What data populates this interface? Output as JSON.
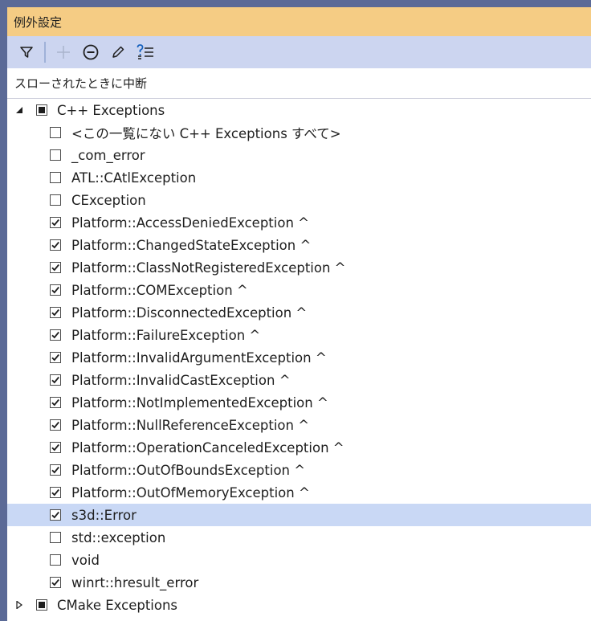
{
  "window": {
    "title": "例外設定"
  },
  "toolbar": {
    "buttons": [
      {
        "name": "filter-icon"
      },
      {
        "name": "add-icon"
      },
      {
        "name": "remove-icon"
      },
      {
        "name": "edit-icon"
      },
      {
        "name": "restore-defaults-icon"
      }
    ]
  },
  "column": {
    "header": "スローされたときに中断"
  },
  "tree": {
    "groups": [
      {
        "label": "C++ Exceptions",
        "expanded": true,
        "state": "indeterminate",
        "items": [
          {
            "label": "<この一覧にない C++ Exceptions すべて>",
            "checked": false
          },
          {
            "label": "_com_error",
            "checked": false
          },
          {
            "label": "ATL::CAtlException",
            "checked": false
          },
          {
            "label": "CException",
            "checked": false
          },
          {
            "label": "Platform::AccessDeniedException ^",
            "checked": true
          },
          {
            "label": "Platform::ChangedStateException ^",
            "checked": true
          },
          {
            "label": "Platform::ClassNotRegisteredException ^",
            "checked": true
          },
          {
            "label": "Platform::COMException ^",
            "checked": true
          },
          {
            "label": "Platform::DisconnectedException ^",
            "checked": true
          },
          {
            "label": "Platform::FailureException ^",
            "checked": true
          },
          {
            "label": "Platform::InvalidArgumentException ^",
            "checked": true
          },
          {
            "label": "Platform::InvalidCastException ^",
            "checked": true
          },
          {
            "label": "Platform::NotImplementedException ^",
            "checked": true
          },
          {
            "label": "Platform::NullReferenceException ^",
            "checked": true
          },
          {
            "label": "Platform::OperationCanceledException ^",
            "checked": true
          },
          {
            "label": "Platform::OutOfBoundsException ^",
            "checked": true
          },
          {
            "label": "Platform::OutOfMemoryException ^",
            "checked": true
          },
          {
            "label": "s3d::Error",
            "checked": true,
            "selected": true
          },
          {
            "label": "std::exception",
            "checked": false
          },
          {
            "label": "void",
            "checked": false
          },
          {
            "label": "winrt::hresult_error",
            "checked": true
          }
        ]
      },
      {
        "label": "CMake Exceptions",
        "expanded": false,
        "state": "indeterminate",
        "items": []
      }
    ]
  },
  "colors": {
    "title_bar": "#f5cc84",
    "toolbar": "#ccd5f0",
    "selection": "#c9d8f5",
    "outer": "#5b6a97"
  }
}
